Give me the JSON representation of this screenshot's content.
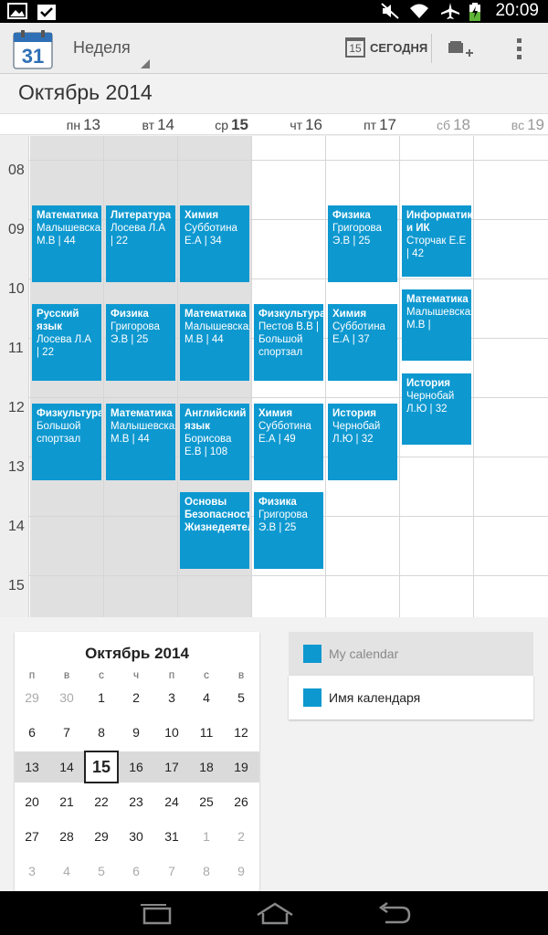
{
  "status_bar": {
    "time": "20:09"
  },
  "action_bar": {
    "app_icon_day": "31",
    "view_label": "Неделя",
    "today_icon_day": "15",
    "today_label": "СЕГОДНЯ"
  },
  "month_title": "Октябрь 2014",
  "days": [
    {
      "dow": "пн",
      "num": "13"
    },
    {
      "dow": "вт",
      "num": "14"
    },
    {
      "dow": "ср",
      "num": "15"
    },
    {
      "dow": "чт",
      "num": "16"
    },
    {
      "dow": "пт",
      "num": "17"
    },
    {
      "dow": "сб",
      "num": "18"
    },
    {
      "dow": "вс",
      "num": "19"
    }
  ],
  "hours": [
    "08",
    "09",
    "10",
    "11",
    "12",
    "13",
    "14",
    "15"
  ],
  "events": [
    {
      "title": "Математика",
      "detail": "Малышевская М.В | 44"
    },
    {
      "title": "Литература",
      "detail": "Лосева Л.А | 22"
    },
    {
      "title": "Химия",
      "detail": "Субботина Е.А | 34"
    },
    {
      "title": "Физика",
      "detail": "Григорова Э.В | 25"
    },
    {
      "title": "Информатика и ИК",
      "detail": "Сторчак Е.Е | 42"
    },
    {
      "title": "Русский язык",
      "detail": "Лосева Л.А | 22"
    },
    {
      "title": "Физика",
      "detail": "Григорова Э.В | 25"
    },
    {
      "title": "Математика",
      "detail": "Малышевская М.В | 44"
    },
    {
      "title": "Физкультура",
      "detail": "Пестов В.В | Большой спортзал"
    },
    {
      "title": "Химия",
      "detail": "Субботина Е.А | 37"
    },
    {
      "title": "Математика",
      "detail": "Малышевская М.В |"
    },
    {
      "title": "Физкультура",
      "detail": "Большой спортзал"
    },
    {
      "title": "Математика",
      "detail": "Малышевская М.В | 44"
    },
    {
      "title": "Английский язык",
      "detail": "Борисова Е.В | 108"
    },
    {
      "title": "Химия",
      "detail": "Субботина Е.А | 49"
    },
    {
      "title": "История",
      "detail": "Чернобай Л.Ю | 32"
    },
    {
      "title": "История",
      "detail": "Чернобай Л.Ю | 32"
    },
    {
      "title": "Основы Безопасности Жизнедеятельности",
      "detail": ""
    },
    {
      "title": "Физика",
      "detail": "Григорова Э.В | 25"
    }
  ],
  "mini_calendar": {
    "title": "Октябрь 2014",
    "dow": [
      "п",
      "в",
      "с",
      "ч",
      "п",
      "с",
      "в"
    ],
    "weeks": [
      [
        "29",
        "30",
        "1",
        "2",
        "3",
        "4",
        "5"
      ],
      [
        "6",
        "7",
        "8",
        "9",
        "10",
        "11",
        "12"
      ],
      [
        "13",
        "14",
        "15",
        "16",
        "17",
        "18",
        "19"
      ],
      [
        "20",
        "21",
        "22",
        "23",
        "24",
        "25",
        "26"
      ],
      [
        "27",
        "28",
        "29",
        "30",
        "31",
        "1",
        "2"
      ],
      [
        "3",
        "4",
        "5",
        "6",
        "7",
        "8",
        "9"
      ]
    ]
  },
  "calendars": [
    {
      "name": "My calendar",
      "color": "#0d98d0"
    },
    {
      "name": "Имя календаря",
      "color": "#0d98d0"
    }
  ],
  "colors": {
    "event": "#0d98d0",
    "past_column": "#e0e0e0"
  }
}
